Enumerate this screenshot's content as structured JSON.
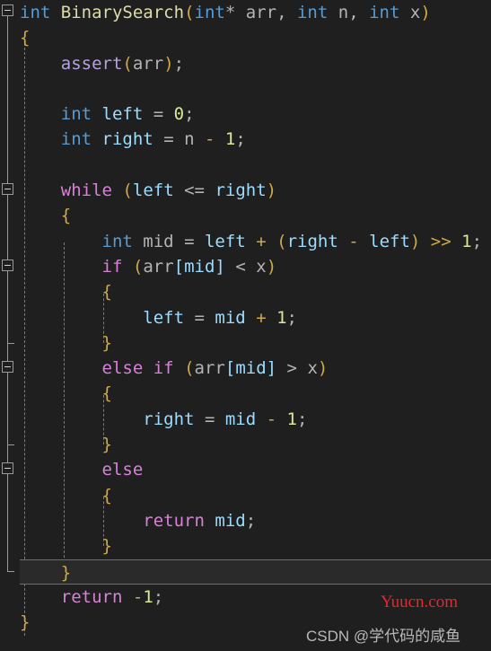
{
  "editor": {
    "language": "cpp",
    "background_color": "#1f1f1f",
    "current_line_index": 22,
    "colors": {
      "keyword_type": "#569cd6",
      "keyword_control": "#d782d7",
      "function_name": "#dcdcaa",
      "local_variable": "#9cdcfe",
      "plain_identifier": "#b4b4b4",
      "punctuation": "#cfa94a",
      "number_literal": "#d7ea9b",
      "macro": "#b8a0e8"
    },
    "lines": [
      {
        "index": 0,
        "fold": "open",
        "tokens": [
          {
            "text": "int",
            "cls": "t-kw"
          },
          {
            "text": " ",
            "cls": "t-plain"
          },
          {
            "text": "BinarySearch",
            "cls": "t-fn"
          },
          {
            "text": "(",
            "cls": "t-punct"
          },
          {
            "text": "int",
            "cls": "t-kw"
          },
          {
            "text": "*",
            "cls": "t-op"
          },
          {
            "text": " arr",
            "cls": "t-plain"
          },
          {
            "text": ",",
            "cls": "t-op"
          },
          {
            "text": " ",
            "cls": "t-plain"
          },
          {
            "text": "int",
            "cls": "t-kw"
          },
          {
            "text": " n",
            "cls": "t-plain"
          },
          {
            "text": ",",
            "cls": "t-op"
          },
          {
            "text": " ",
            "cls": "t-plain"
          },
          {
            "text": "int",
            "cls": "t-kw"
          },
          {
            "text": " x",
            "cls": "t-plain"
          },
          {
            "text": ")",
            "cls": "t-punct"
          }
        ]
      },
      {
        "index": 1,
        "tokens": [
          {
            "text": "{",
            "cls": "t-punct"
          }
        ]
      },
      {
        "index": 2,
        "tokens": [
          {
            "text": "    ",
            "cls": "t-plain"
          },
          {
            "text": "assert",
            "cls": "t-macro"
          },
          {
            "text": "(",
            "cls": "t-punct"
          },
          {
            "text": "arr",
            "cls": "t-plain"
          },
          {
            "text": ")",
            "cls": "t-punct"
          },
          {
            "text": ";",
            "cls": "t-op"
          }
        ]
      },
      {
        "index": 3,
        "tokens": []
      },
      {
        "index": 4,
        "tokens": [
          {
            "text": "    ",
            "cls": "t-plain"
          },
          {
            "text": "int",
            "cls": "t-kw"
          },
          {
            "text": " ",
            "cls": "t-plain"
          },
          {
            "text": "left",
            "cls": "t-var"
          },
          {
            "text": " ",
            "cls": "t-plain"
          },
          {
            "text": "=",
            "cls": "t-op"
          },
          {
            "text": " ",
            "cls": "t-plain"
          },
          {
            "text": "0",
            "cls": "t-num"
          },
          {
            "text": ";",
            "cls": "t-op"
          }
        ]
      },
      {
        "index": 5,
        "tokens": [
          {
            "text": "    ",
            "cls": "t-plain"
          },
          {
            "text": "int",
            "cls": "t-kw"
          },
          {
            "text": " ",
            "cls": "t-plain"
          },
          {
            "text": "right",
            "cls": "t-var"
          },
          {
            "text": " ",
            "cls": "t-plain"
          },
          {
            "text": "=",
            "cls": "t-op"
          },
          {
            "text": " ",
            "cls": "t-plain"
          },
          {
            "text": "n",
            "cls": "t-plain"
          },
          {
            "text": " ",
            "cls": "t-plain"
          },
          {
            "text": "-",
            "cls": "t-punct"
          },
          {
            "text": " ",
            "cls": "t-plain"
          },
          {
            "text": "1",
            "cls": "t-num"
          },
          {
            "text": ";",
            "cls": "t-op"
          }
        ]
      },
      {
        "index": 6,
        "tokens": []
      },
      {
        "index": 7,
        "fold": "open",
        "tokens": [
          {
            "text": "    ",
            "cls": "t-plain"
          },
          {
            "text": "while",
            "cls": "t-ctrl"
          },
          {
            "text": " ",
            "cls": "t-plain"
          },
          {
            "text": "(",
            "cls": "t-punct"
          },
          {
            "text": "left",
            "cls": "t-var"
          },
          {
            "text": " ",
            "cls": "t-plain"
          },
          {
            "text": "<=",
            "cls": "t-op"
          },
          {
            "text": " ",
            "cls": "t-plain"
          },
          {
            "text": "right",
            "cls": "t-var"
          },
          {
            "text": ")",
            "cls": "t-punct"
          }
        ]
      },
      {
        "index": 8,
        "tokens": [
          {
            "text": "    ",
            "cls": "t-plain"
          },
          {
            "text": "{",
            "cls": "t-punct"
          }
        ]
      },
      {
        "index": 9,
        "tokens": [
          {
            "text": "        ",
            "cls": "t-plain"
          },
          {
            "text": "int",
            "cls": "t-kw"
          },
          {
            "text": " ",
            "cls": "t-plain"
          },
          {
            "text": "mid",
            "cls": "t-plain"
          },
          {
            "text": " ",
            "cls": "t-plain"
          },
          {
            "text": "=",
            "cls": "t-op"
          },
          {
            "text": " ",
            "cls": "t-plain"
          },
          {
            "text": "left",
            "cls": "t-var"
          },
          {
            "text": " ",
            "cls": "t-plain"
          },
          {
            "text": "+",
            "cls": "t-punct"
          },
          {
            "text": " ",
            "cls": "t-plain"
          },
          {
            "text": "(",
            "cls": "t-punct"
          },
          {
            "text": "right",
            "cls": "t-var"
          },
          {
            "text": " ",
            "cls": "t-plain"
          },
          {
            "text": "-",
            "cls": "t-punct"
          },
          {
            "text": " ",
            "cls": "t-plain"
          },
          {
            "text": "left",
            "cls": "t-var"
          },
          {
            "text": ")",
            "cls": "t-punct"
          },
          {
            "text": " ",
            "cls": "t-plain"
          },
          {
            "text": ">>",
            "cls": "t-punct"
          },
          {
            "text": " ",
            "cls": "t-plain"
          },
          {
            "text": "1",
            "cls": "t-num"
          },
          {
            "text": ";",
            "cls": "t-op"
          }
        ]
      },
      {
        "index": 10,
        "fold": "open",
        "tokens": [
          {
            "text": "        ",
            "cls": "t-plain"
          },
          {
            "text": "if",
            "cls": "t-ctrl"
          },
          {
            "text": " ",
            "cls": "t-plain"
          },
          {
            "text": "(",
            "cls": "t-punct"
          },
          {
            "text": "arr",
            "cls": "t-plain"
          },
          {
            "text": "[",
            "cls": "t-brk"
          },
          {
            "text": "mid",
            "cls": "t-var"
          },
          {
            "text": "]",
            "cls": "t-brk"
          },
          {
            "text": " ",
            "cls": "t-plain"
          },
          {
            "text": "<",
            "cls": "t-op"
          },
          {
            "text": " ",
            "cls": "t-plain"
          },
          {
            "text": "x",
            "cls": "t-plain"
          },
          {
            "text": ")",
            "cls": "t-punct"
          }
        ]
      },
      {
        "index": 11,
        "tokens": [
          {
            "text": "        ",
            "cls": "t-plain"
          },
          {
            "text": "{",
            "cls": "t-punct"
          }
        ]
      },
      {
        "index": 12,
        "tokens": [
          {
            "text": "            ",
            "cls": "t-plain"
          },
          {
            "text": "left",
            "cls": "t-var"
          },
          {
            "text": " ",
            "cls": "t-plain"
          },
          {
            "text": "=",
            "cls": "t-op"
          },
          {
            "text": " ",
            "cls": "t-plain"
          },
          {
            "text": "mid",
            "cls": "t-var"
          },
          {
            "text": " ",
            "cls": "t-plain"
          },
          {
            "text": "+",
            "cls": "t-punct"
          },
          {
            "text": " ",
            "cls": "t-plain"
          },
          {
            "text": "1",
            "cls": "t-num"
          },
          {
            "text": ";",
            "cls": "t-op"
          }
        ]
      },
      {
        "index": 13,
        "tokens": [
          {
            "text": "        ",
            "cls": "t-plain"
          },
          {
            "text": "}",
            "cls": "t-punct"
          }
        ]
      },
      {
        "index": 14,
        "fold": "open",
        "tokens": [
          {
            "text": "        ",
            "cls": "t-plain"
          },
          {
            "text": "else",
            "cls": "t-ctrl"
          },
          {
            "text": " ",
            "cls": "t-plain"
          },
          {
            "text": "if",
            "cls": "t-ctrl"
          },
          {
            "text": " ",
            "cls": "t-plain"
          },
          {
            "text": "(",
            "cls": "t-punct"
          },
          {
            "text": "arr",
            "cls": "t-plain"
          },
          {
            "text": "[",
            "cls": "t-brk"
          },
          {
            "text": "mid",
            "cls": "t-var"
          },
          {
            "text": "]",
            "cls": "t-brk"
          },
          {
            "text": " ",
            "cls": "t-plain"
          },
          {
            "text": ">",
            "cls": "t-op"
          },
          {
            "text": " ",
            "cls": "t-plain"
          },
          {
            "text": "x",
            "cls": "t-plain"
          },
          {
            "text": ")",
            "cls": "t-punct"
          }
        ]
      },
      {
        "index": 15,
        "tokens": [
          {
            "text": "        ",
            "cls": "t-plain"
          },
          {
            "text": "{",
            "cls": "t-punct"
          }
        ]
      },
      {
        "index": 16,
        "tokens": [
          {
            "text": "            ",
            "cls": "t-plain"
          },
          {
            "text": "right",
            "cls": "t-var"
          },
          {
            "text": " ",
            "cls": "t-plain"
          },
          {
            "text": "=",
            "cls": "t-op"
          },
          {
            "text": " ",
            "cls": "t-plain"
          },
          {
            "text": "mid",
            "cls": "t-var"
          },
          {
            "text": " ",
            "cls": "t-plain"
          },
          {
            "text": "-",
            "cls": "t-punct"
          },
          {
            "text": " ",
            "cls": "t-plain"
          },
          {
            "text": "1",
            "cls": "t-num"
          },
          {
            "text": ";",
            "cls": "t-op"
          }
        ]
      },
      {
        "index": 17,
        "tokens": [
          {
            "text": "        ",
            "cls": "t-plain"
          },
          {
            "text": "}",
            "cls": "t-punct"
          }
        ]
      },
      {
        "index": 18,
        "fold": "open",
        "tokens": [
          {
            "text": "        ",
            "cls": "t-plain"
          },
          {
            "text": "else",
            "cls": "t-ctrl"
          }
        ]
      },
      {
        "index": 19,
        "tokens": [
          {
            "text": "        ",
            "cls": "t-plain"
          },
          {
            "text": "{",
            "cls": "t-punct"
          }
        ]
      },
      {
        "index": 20,
        "tokens": [
          {
            "text": "            ",
            "cls": "t-plain"
          },
          {
            "text": "return",
            "cls": "t-ctrl"
          },
          {
            "text": " ",
            "cls": "t-plain"
          },
          {
            "text": "mid",
            "cls": "t-var"
          },
          {
            "text": ";",
            "cls": "t-op"
          }
        ]
      },
      {
        "index": 21,
        "tokens": [
          {
            "text": "        ",
            "cls": "t-plain"
          },
          {
            "text": "}",
            "cls": "t-punct"
          }
        ]
      },
      {
        "index": 22,
        "current": true,
        "tokens": [
          {
            "text": "    ",
            "cls": "t-plain"
          },
          {
            "text": "}",
            "cls": "t-punct"
          }
        ]
      },
      {
        "index": 23,
        "tokens": [
          {
            "text": "    ",
            "cls": "t-plain"
          },
          {
            "text": "return",
            "cls": "t-ctrl"
          },
          {
            "text": " ",
            "cls": "t-plain"
          },
          {
            "text": "-",
            "cls": "t-punct"
          },
          {
            "text": "1",
            "cls": "t-num"
          },
          {
            "text": ";",
            "cls": "t-op"
          }
        ]
      },
      {
        "index": 24,
        "tokens": [
          {
            "text": "}",
            "cls": "t-punct"
          }
        ]
      }
    ]
  },
  "watermarks": {
    "site": "Yuucn.com",
    "site_color": "#e8262b",
    "author": "CSDN @学代码的咸鱼",
    "author_color": "#b9b9b9"
  }
}
